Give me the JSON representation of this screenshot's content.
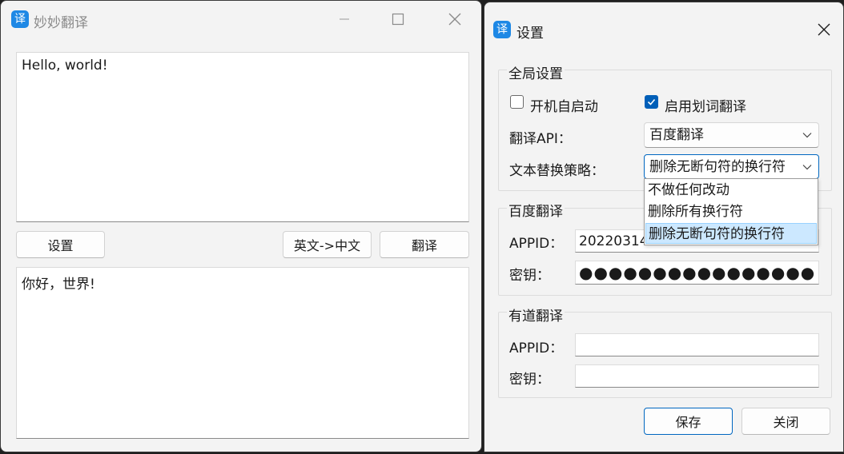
{
  "main_window": {
    "title": "妙妙翻译",
    "icon_glyph": "译",
    "source_text": "Hello, world!",
    "result_text": "你好，世界!",
    "settings_button": "设置",
    "direction_button": "英文->中文",
    "translate_button": "翻译"
  },
  "settings_window": {
    "title": "设置",
    "icon_glyph": "译",
    "global": {
      "title": "全局设置",
      "autostart_label": "开机自启动",
      "autostart_checked": false,
      "selection_translate_label": "启用划词翻译",
      "selection_translate_checked": true,
      "api_label": "翻译API：",
      "api_value": "百度翻译",
      "strategy_label": "文本替换策略：",
      "strategy_value": "删除无断句符的换行符",
      "strategy_options": [
        "不做任何改动",
        "删除所有换行符",
        "删除无断句符的换行符"
      ],
      "strategy_selected_index": 2
    },
    "baidu": {
      "title": "百度翻译",
      "appid_label": "APPID：",
      "appid_value": "20220314",
      "key_label": "密钥：",
      "key_value": "●●●●●●●●●●●●●●●●●●●●"
    },
    "youdao": {
      "title": "有道翻译",
      "appid_label": "APPID：",
      "appid_value": "",
      "key_label": "密钥：",
      "key_value": ""
    },
    "save_button": "保存",
    "close_button": "关闭"
  },
  "colors": {
    "accent": "#005fb8",
    "app_icon": "#1e88e5",
    "window_bg": "#f3f3f3",
    "selected_item": "#cce8ff"
  }
}
